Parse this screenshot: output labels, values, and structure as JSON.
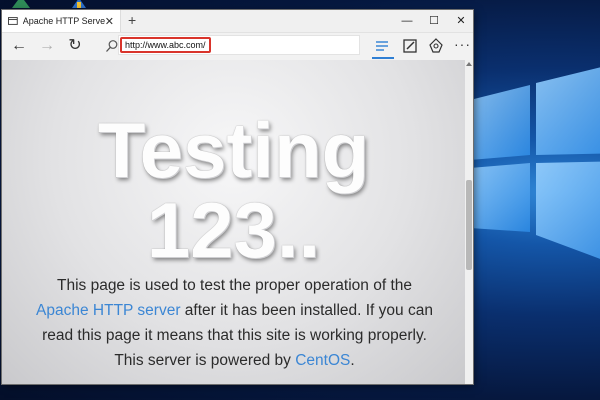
{
  "browser": {
    "tab_title": "Apache HTTP Server Tes",
    "tab_close": "✕",
    "new_tab": "+",
    "window_controls": {
      "minimize": "—",
      "maximize": "☐",
      "close": "✕"
    },
    "nav": {
      "back": "←",
      "forward": "→",
      "refresh": "↻"
    },
    "address_value": "http://www.abc.com/",
    "more_label": "···",
    "accent_color": "#2f7fd4",
    "highlight_color": "#d9342b"
  },
  "page": {
    "hero_line1": "Testing",
    "hero_line2": "123..",
    "desc_part1": "This page is used to test the proper operation of the ",
    "desc_link1": "Apache HTTP server",
    "desc_part2": " after it has been installed. If you can read this page it means that this site is working properly. This server is powered by ",
    "desc_link2": "CentOS",
    "desc_part3": "."
  },
  "icons": [
    "browser-tab-icon",
    "search-icon",
    "hub-icon",
    "web-note-icon",
    "share-icon",
    "windows-logo-icon"
  ]
}
